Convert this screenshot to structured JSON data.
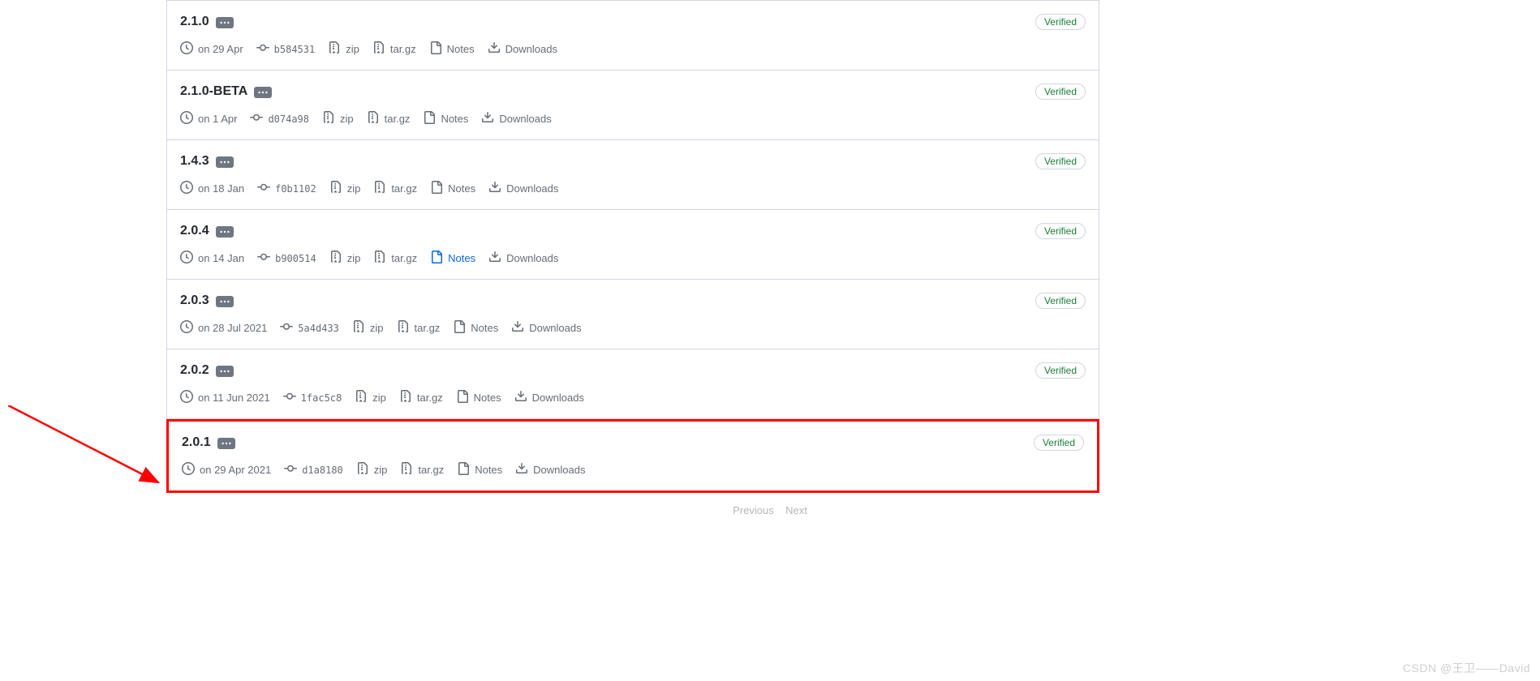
{
  "verified_label": "Verified",
  "meta_labels": {
    "zip": "zip",
    "targz": "tar.gz",
    "notes": "Notes",
    "downloads": "Downloads"
  },
  "releases": [
    {
      "version": "2.1.0",
      "date": "on 29 Apr",
      "commit": "b584531",
      "notes_blue": false
    },
    {
      "version": "2.1.0-BETA",
      "date": "on 1 Apr",
      "commit": "d074a98",
      "notes_blue": false
    },
    {
      "version": "1.4.3",
      "date": "on 18 Jan",
      "commit": "f0b1102",
      "notes_blue": false
    },
    {
      "version": "2.0.4",
      "date": "on 14 Jan",
      "commit": "b900514",
      "notes_blue": true
    },
    {
      "version": "2.0.3",
      "date": "on 28 Jul 2021",
      "commit": "5a4d433",
      "notes_blue": false
    },
    {
      "version": "2.0.2",
      "date": "on 11 Jun 2021",
      "commit": "1fac5c8",
      "notes_blue": false
    },
    {
      "version": "2.0.1",
      "date": "on 29 Apr 2021",
      "commit": "d1a8180",
      "notes_blue": false
    }
  ],
  "pagination": {
    "prev": "Previous",
    "next": "Next"
  },
  "watermark": "CSDN @王卫——David"
}
